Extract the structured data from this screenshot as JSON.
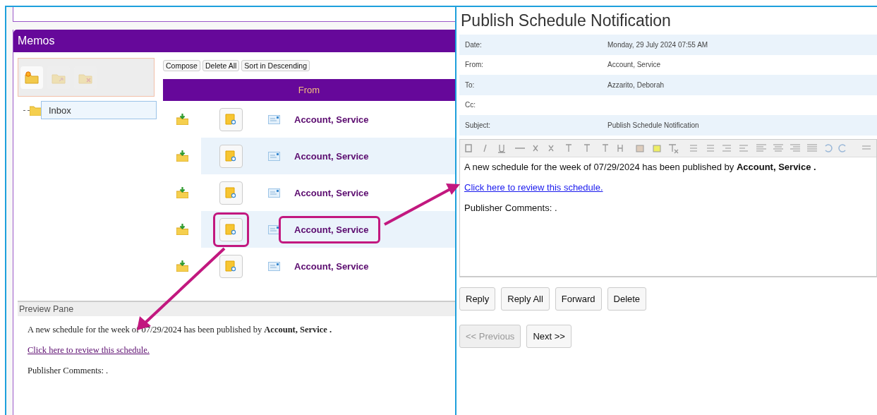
{
  "memos": {
    "title": "Memos",
    "folder_tools": [
      {
        "kind": "new",
        "disabled": false
      },
      {
        "kind": "move",
        "disabled": true
      },
      {
        "kind": "delete",
        "disabled": true
      }
    ],
    "folders": [
      {
        "label": "Inbox",
        "selected": true
      }
    ],
    "actions": [
      "Compose",
      "Delete All",
      "Sort in Descending"
    ],
    "columns": [
      "From"
    ],
    "rows": [
      {
        "from": "Account, Service",
        "highlighted": false
      },
      {
        "from": "Account, Service",
        "highlighted": false
      },
      {
        "from": "Account, Service",
        "highlighted": false
      },
      {
        "from": "Account, Service",
        "highlighted": true
      },
      {
        "from": "Account, Service",
        "highlighted": false
      }
    ],
    "preview": {
      "title": "Preview Pane",
      "body": "A new schedule for the week of 07/29/2024 has been published by **Account, Service .**",
      "link": "Click here to review this schedule.",
      "comments": "Publisher Comments: ."
    }
  },
  "notification": {
    "title": "Publish Schedule Notification",
    "fields": [
      {
        "label": "Date:",
        "value": "Monday, 29 July 2024 07:55 AM"
      },
      {
        "label": "From:",
        "value": "Account, Service"
      },
      {
        "label": "To:",
        "value": "Azzarito, Deborah"
      },
      {
        "label": "Cc:"
      },
      {
        "label": "Subject:",
        "value": "Publish Schedule Notification"
      }
    ],
    "body": "A new schedule for the week of 07/29/2024 has been published by **Account, Service .**",
    "link": "Click here to review this schedule.",
    "comments": "Publisher Comments: .",
    "buttons": [
      {
        "label": "Reply",
        "disabled": false
      },
      {
        "label": "Reply All",
        "disabled": false
      },
      {
        "label": "Forward",
        "disabled": false
      },
      {
        "label": "Delete",
        "disabled": false
      }
    ],
    "nav": [
      {
        "label": "<< Previous",
        "disabled": true
      },
      {
        "label": "Next >>",
        "disabled": false
      }
    ]
  }
}
